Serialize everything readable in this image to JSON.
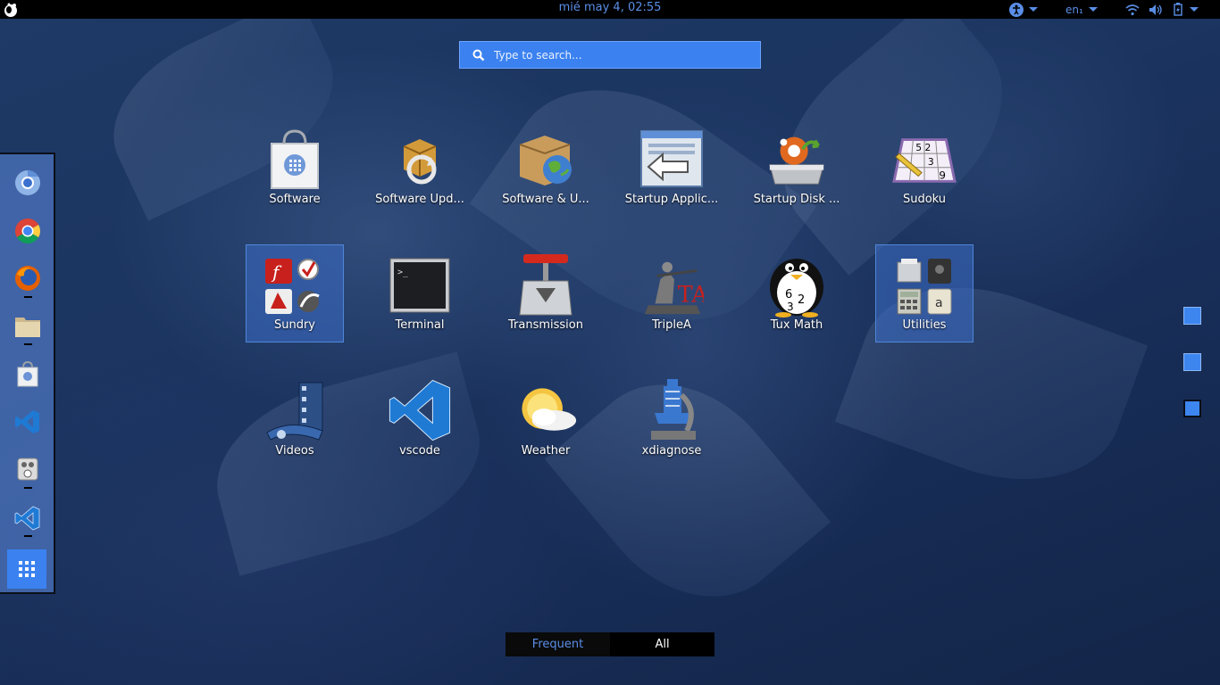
{
  "topbar": {
    "clock": "mié may  4, 02:55",
    "keyboard": "en₁",
    "icons": [
      "activities-icon",
      "accessibility-icon",
      "wifi-icon",
      "volume-icon",
      "battery-icon"
    ]
  },
  "search": {
    "placeholder": "Type to search..."
  },
  "dash": {
    "items": [
      "chromium",
      "chrome",
      "firefox",
      "files",
      "software",
      "vscode",
      "sound-recorder",
      "vscode-insiders"
    ],
    "show_apps": "show-apps"
  },
  "apps": [
    {
      "label": "Software",
      "icon": "software-bag-icon"
    },
    {
      "label": "Software Upd...",
      "icon": "software-update-icon"
    },
    {
      "label": "Software & U...",
      "icon": "software-sources-icon"
    },
    {
      "label": "Startup Applic...",
      "icon": "startup-applications-icon"
    },
    {
      "label": "Startup Disk ...",
      "icon": "startup-disk-icon"
    },
    {
      "label": "Sudoku",
      "icon": "sudoku-icon"
    },
    {
      "label": "Sundry",
      "icon": "sundry-folder-icon"
    },
    {
      "label": "Terminal",
      "icon": "terminal-icon"
    },
    {
      "label": "Transmission",
      "icon": "transmission-icon"
    },
    {
      "label": "TripleA",
      "icon": "triplea-icon"
    },
    {
      "label": "Tux Math",
      "icon": "tux-math-icon"
    },
    {
      "label": "Utilities",
      "icon": "utilities-folder-icon"
    },
    {
      "label": "Videos",
      "icon": "videos-icon"
    },
    {
      "label": "vscode",
      "icon": "vscode-icon"
    },
    {
      "label": "Weather",
      "icon": "weather-icon"
    },
    {
      "label": "xdiagnose",
      "icon": "xdiagnose-icon"
    }
  ],
  "tabs": {
    "frequent": "Frequent",
    "all": "All"
  },
  "colors": {
    "accent": "#3b82f0",
    "clock": "#5a8ee6",
    "panel": "#000000"
  }
}
